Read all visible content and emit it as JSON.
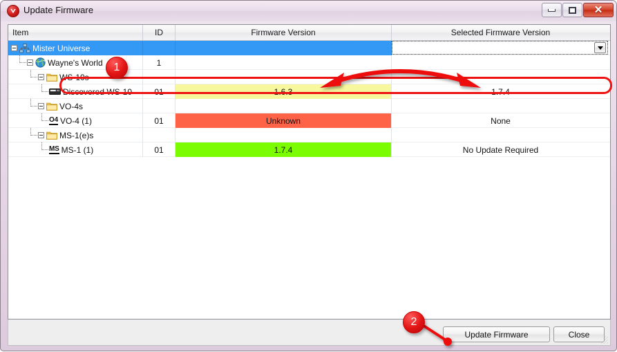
{
  "window": {
    "title": "Update Firmware",
    "app_icon": "shield-v-icon",
    "controls": {
      "minimize": "minimize-icon",
      "maximize": "maximize-icon",
      "close": "✕"
    }
  },
  "table": {
    "columns": [
      {
        "key": "item",
        "label": "Item"
      },
      {
        "key": "id",
        "label": "ID"
      },
      {
        "key": "firmware",
        "label": "Firmware Version"
      },
      {
        "key": "selected",
        "label": "Selected Firmware Version"
      }
    ],
    "rows": [
      {
        "item": "Mister Universe",
        "id": "",
        "firmware": "",
        "selected": "",
        "indent": 0,
        "icon": "network-icon",
        "expander": true,
        "state": "selected",
        "fw_status": "none",
        "sel_control": "combobox"
      },
      {
        "item": "Wayne's World",
        "id": "1",
        "firmware": "",
        "selected": "",
        "indent": 1,
        "icon": "globe-icon",
        "expander": true,
        "state": "normal",
        "fw_status": "none",
        "sel_control": "text"
      },
      {
        "item": "WS-10s",
        "id": "",
        "firmware": "",
        "selected": "",
        "indent": 2,
        "icon": "folder-icon",
        "expander": true,
        "state": "normal",
        "fw_status": "none",
        "sel_control": "text"
      },
      {
        "item": "Discovered WS-10",
        "id": "01",
        "firmware": "1.6.3",
        "selected": "1.7.4",
        "indent": 3,
        "icon": "device-ws10-icon",
        "expander": false,
        "state": "highlighted",
        "fw_status": "outdated",
        "sel_control": "text"
      },
      {
        "item": "VO-4s",
        "id": "",
        "firmware": "",
        "selected": "",
        "indent": 2,
        "icon": "folder-icon",
        "expander": true,
        "state": "normal",
        "fw_status": "none",
        "sel_control": "text"
      },
      {
        "item": "VO-4 (1)",
        "id": "01",
        "firmware": "Unknown",
        "selected": "None",
        "indent": 3,
        "icon": "device-o4-icon",
        "icon_text": "O4",
        "expander": false,
        "state": "normal",
        "fw_status": "unknown",
        "sel_control": "text"
      },
      {
        "item": "MS-1(e)s",
        "id": "",
        "firmware": "",
        "selected": "",
        "indent": 2,
        "icon": "folder-icon",
        "expander": true,
        "state": "normal",
        "fw_status": "none",
        "sel_control": "text"
      },
      {
        "item": "MS-1 (1)",
        "id": "01",
        "firmware": "1.7.4",
        "selected": "No Update Required",
        "indent": 3,
        "icon": "device-ms-icon",
        "icon_text": "MS",
        "expander": false,
        "state": "normal",
        "fw_status": "current",
        "sel_control": "text"
      }
    ]
  },
  "combobox": {
    "value": "",
    "placeholder": ""
  },
  "footer": {
    "update_label": "Update Firmware",
    "close_label": "Close"
  },
  "annotations": {
    "badge_1": "1",
    "badge_2": "2"
  },
  "colors": {
    "status_outdated": "#F7F79E",
    "status_unknown": "#FF6347",
    "status_current": "#7CFC00",
    "row_selected": "#3399F5",
    "annotation_red": "#EE1111",
    "titlebar": "#E9DBE9"
  }
}
